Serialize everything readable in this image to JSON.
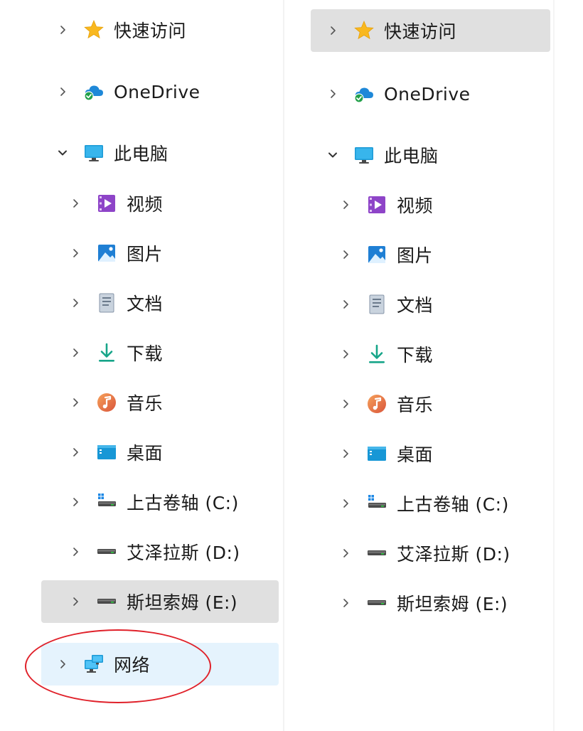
{
  "left_pane": {
    "items": [
      {
        "label": "快速访问",
        "icon": "star-icon",
        "expanded": false
      },
      {
        "label": "OneDrive",
        "icon": "onedrive-icon",
        "expanded": false
      },
      {
        "label": "此电脑",
        "icon": "this-pc-icon",
        "expanded": true
      },
      {
        "label": "视频",
        "icon": "videos-icon",
        "expanded": false
      },
      {
        "label": "图片",
        "icon": "pictures-icon",
        "expanded": false
      },
      {
        "label": "文档",
        "icon": "documents-icon",
        "expanded": false
      },
      {
        "label": "下载",
        "icon": "downloads-icon",
        "expanded": false
      },
      {
        "label": "音乐",
        "icon": "music-icon",
        "expanded": false
      },
      {
        "label": "桌面",
        "icon": "desktop-icon",
        "expanded": false
      },
      {
        "label": "上古卷轴 (C:)",
        "icon": "system-drive-icon",
        "expanded": false
      },
      {
        "label": "艾泽拉斯 (D:)",
        "icon": "drive-icon",
        "expanded": false
      },
      {
        "label": "斯坦索姆 (E:)",
        "icon": "drive-icon",
        "expanded": false,
        "selected": true
      },
      {
        "label": "网络",
        "icon": "network-icon",
        "expanded": false,
        "hover": true
      }
    ]
  },
  "right_pane": {
    "items": [
      {
        "label": "快速访问",
        "icon": "star-icon",
        "expanded": false,
        "selected": true
      },
      {
        "label": "OneDrive",
        "icon": "onedrive-icon",
        "expanded": false
      },
      {
        "label": "此电脑",
        "icon": "this-pc-icon",
        "expanded": true
      },
      {
        "label": "视频",
        "icon": "videos-icon",
        "expanded": false
      },
      {
        "label": "图片",
        "icon": "pictures-icon",
        "expanded": false
      },
      {
        "label": "文档",
        "icon": "documents-icon",
        "expanded": false
      },
      {
        "label": "下载",
        "icon": "downloads-icon",
        "expanded": false
      },
      {
        "label": "音乐",
        "icon": "music-icon",
        "expanded": false
      },
      {
        "label": "桌面",
        "icon": "desktop-icon",
        "expanded": false
      },
      {
        "label": "上古卷轴 (C:)",
        "icon": "system-drive-icon",
        "expanded": false
      },
      {
        "label": "艾泽拉斯 (D:)",
        "icon": "drive-icon",
        "expanded": false
      },
      {
        "label": "斯坦索姆 (E:)",
        "icon": "drive-icon",
        "expanded": false
      }
    ]
  },
  "colors": {
    "selected_bg": "#e0e0e0",
    "hover_bg": "#e5f3fd",
    "annotation_circle": "#e0212a"
  }
}
